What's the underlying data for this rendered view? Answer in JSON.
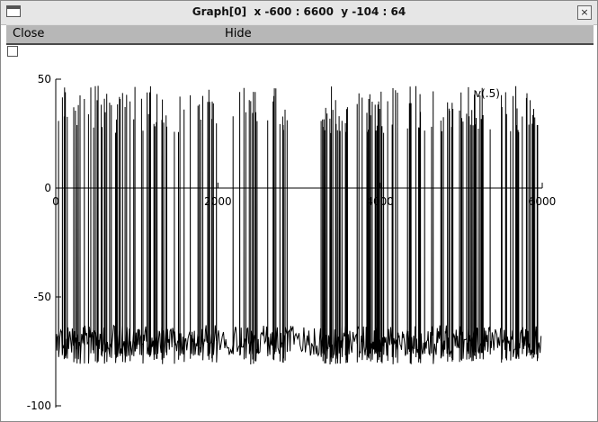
{
  "window": {
    "title": "Graph[0]  x -600 : 6600  y -104 : 64",
    "icons": [
      "window-menu-icon",
      "close-icon"
    ],
    "close_glyph": "×"
  },
  "menu": {
    "close_label": "Close",
    "hide_label": "Hide"
  },
  "chart_data": {
    "type": "line",
    "series": [
      {
        "name": "v(.5)"
      }
    ],
    "x_ticks": [
      "0",
      "2000",
      "4000",
      "6000"
    ],
    "y_ticks": [
      "50",
      "0",
      "-50",
      "-100"
    ],
    "xlim": [
      0,
      6000
    ],
    "ylim": [
      -100,
      50
    ],
    "view_x_range": [
      -600,
      6600
    ],
    "view_y_range": [
      -104,
      64
    ],
    "resting_potential": -70,
    "spike_peak_range": [
      25,
      47
    ],
    "spike_count": 230,
    "line_color": "#000000"
  }
}
